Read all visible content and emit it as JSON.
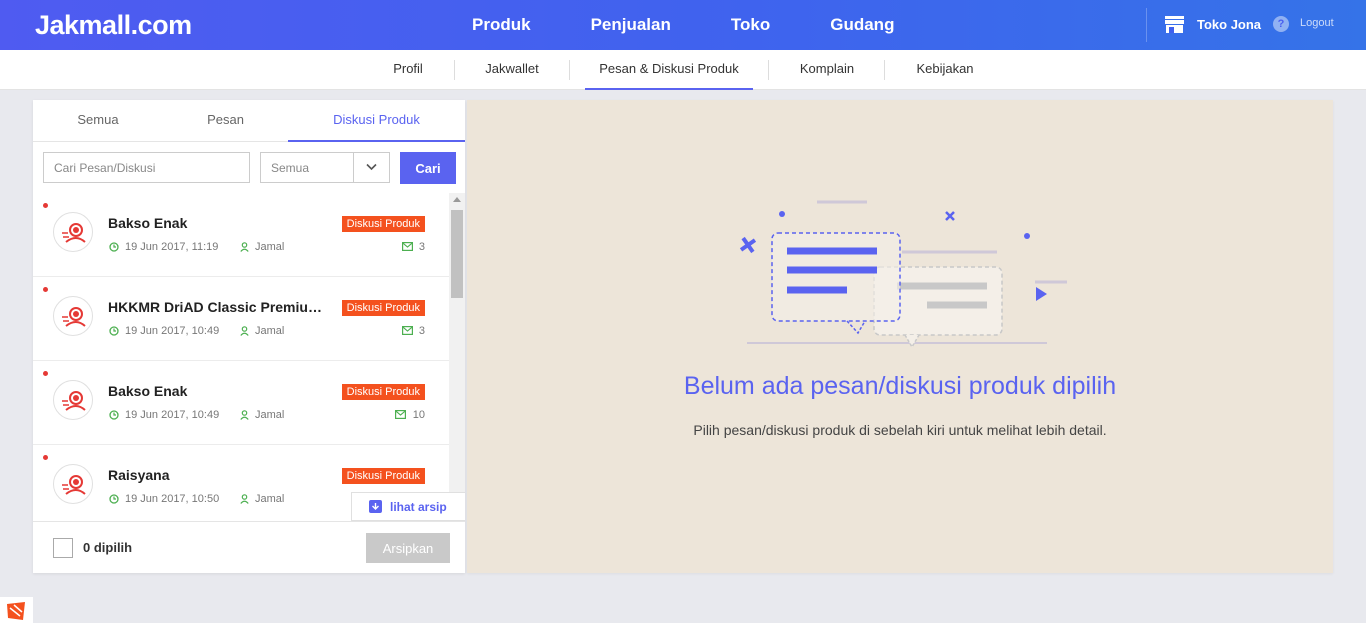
{
  "brand": {
    "logo": "Jakmall.com"
  },
  "main_nav": [
    {
      "label": "Produk"
    },
    {
      "label": "Penjualan"
    },
    {
      "label": "Toko"
    },
    {
      "label": "Gudang"
    }
  ],
  "user": {
    "store_name": "Toko Jona",
    "help": "?",
    "logout_label": "Logout"
  },
  "sub_nav": [
    {
      "label": "Profil"
    },
    {
      "label": "Jakwallet"
    },
    {
      "label": "Pesan & Diskusi Produk",
      "active": true
    },
    {
      "label": "Komplain"
    },
    {
      "label": "Kebijakan"
    }
  ],
  "tabs": [
    {
      "label": "Semua"
    },
    {
      "label": "Pesan"
    },
    {
      "label": "Diskusi Produk",
      "active": true
    }
  ],
  "search": {
    "placeholder": "Cari Pesan/Diskusi",
    "value": "",
    "filter_value": "Semua",
    "button_label": "Cari"
  },
  "list": [
    {
      "title": "Bakso Enak",
      "badge": "Diskusi Produk",
      "date": "19 Jun 2017, 11:19",
      "user": "Jamal",
      "count": "3"
    },
    {
      "title": "HKKMR DriAD Classic Premium Wireless Headset",
      "badge": "Diskusi Produk",
      "date": "19 Jun 2017, 10:49",
      "user": "Jamal",
      "count": "3"
    },
    {
      "title": "Bakso Enak",
      "badge": "Diskusi Produk",
      "date": "19 Jun 2017, 10:49",
      "user": "Jamal",
      "count": "10"
    },
    {
      "title": "Raisyana",
      "badge": "Diskusi Produk",
      "date": "19 Jun 2017, 10:50",
      "user": "Jamal",
      "count": ""
    }
  ],
  "archive_link_label": "lihat arsip",
  "footer": {
    "selected_label": "0 dipilih",
    "archive_button_label": "Arsipkan"
  },
  "empty_state": {
    "title": "Belum ada pesan/diskusi produk dipilih",
    "subtitle": "Pilih pesan/diskusi produk di sebelah kiri untuk melihat lebih detail."
  },
  "colors": {
    "primary": "#5a63f0",
    "badge": "#f4511e",
    "unread": "#e53935",
    "empty_bg": "#ede5d9"
  },
  "icons": [
    "store-icon",
    "help-icon",
    "chevron-down-icon",
    "avatar-icon",
    "clock-icon",
    "user-icon",
    "mail-icon",
    "archive-icon"
  ]
}
